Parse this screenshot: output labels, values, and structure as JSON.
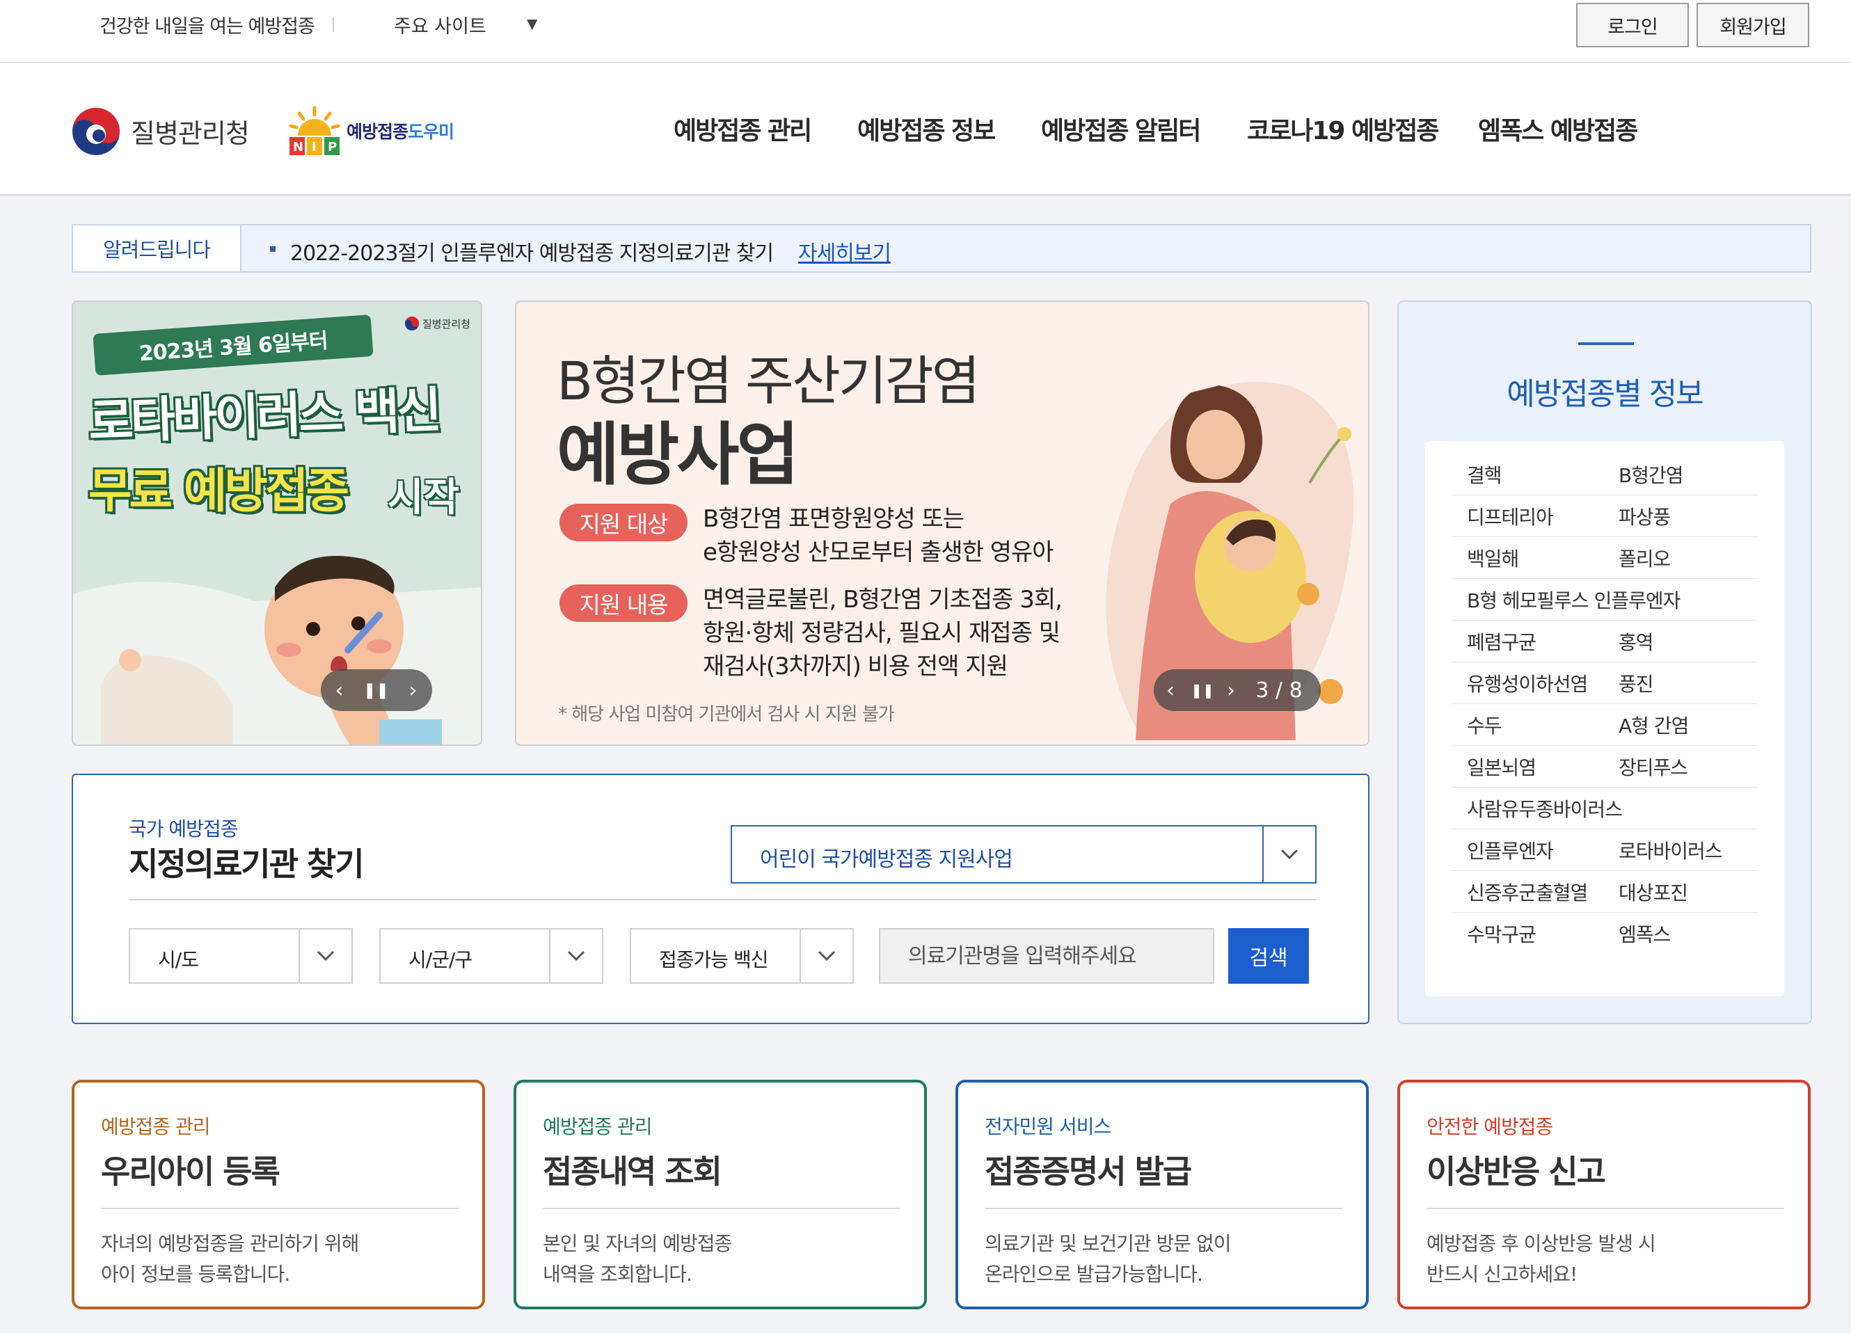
{
  "utility": {
    "slogan": "건강한 내일을 여는 예방접종",
    "sites_label": "주요 사이트",
    "login": "로그인",
    "join": "회원가입"
  },
  "header": {
    "kdca_name": "질병관리청",
    "nip_brand_a": "예방접종",
    "nip_brand_b": "도우미",
    "nav": [
      "예방접종 관리",
      "예방접종 정보",
      "예방접종 알림터",
      "코로나19 예방접종",
      "엠폭스 예방접종"
    ]
  },
  "notice": {
    "label": "알려드립니다",
    "text": "2022-2023절기 인플루엔자 예방접종 지정의료기관 찾기",
    "more": "자세히보기"
  },
  "banner1": {
    "date": "2023년 3월 6일부터",
    "line1": "로타바이러스 백신",
    "line2": "무료 예방접종",
    "line2_end": "시작",
    "kdca": "질병관리청"
  },
  "banner2": {
    "title1": "B형간염 주산기감염",
    "title2": "예방사업",
    "tag1": "지원 대상",
    "desc1_l1": "B형간염 표면항원양성 또는",
    "desc1_l2": "e항원양성 산모로부터 출생한 영유아",
    "tag2": "지원 내용",
    "desc2_l1": "면역글로불린, B형간염 기초접종 3회,",
    "desc2_l2": "항원·항체 정량검사, 필요시 재접종 및",
    "desc2_l3": "재검사(3차까지) 비용 전액 지원",
    "note": "* 해당 사업 미참여 기관에서 검사 시 지원 불가",
    "counter": "3 / 8"
  },
  "info_panel": {
    "title": "예방접종별 정보",
    "rows": [
      [
        "결핵",
        "B형간염"
      ],
      [
        "디프테리아",
        "파상풍"
      ],
      [
        "백일해",
        "폴리오"
      ],
      [
        "B형 헤모필루스 인플루엔자",
        ""
      ],
      [
        "폐렴구균",
        "홍역"
      ],
      [
        "유행성이하선염",
        "풍진"
      ],
      [
        "수두",
        "A형 간염"
      ],
      [
        "일본뇌염",
        "장티푸스"
      ],
      [
        "사람유두종바이러스",
        ""
      ],
      [
        "인플루엔자",
        "로타바이러스"
      ],
      [
        "신증후군출혈열",
        "대상포진"
      ],
      [
        "수막구균",
        "엠폭스"
      ]
    ]
  },
  "search": {
    "sub": "국가 예방접종",
    "heading": "지정의료기관 찾기",
    "program": "어린이 국가예방접종 지원사업",
    "sido": "시/도",
    "sigungu": "시/군/구",
    "vaccine": "접종가능 백신",
    "placeholder": "의료기관명을 입력해주세요",
    "button": "검색"
  },
  "cards": [
    {
      "category": "예방접종 관리",
      "title": "우리아이 등록",
      "desc": "자녀의 예방접종을 관리하기 위해\n아이 정보를 등록합니다.",
      "color": "#b5651d"
    },
    {
      "category": "예방접종 관리",
      "title": "접종내역 조회",
      "desc": "본인 및 자녀의 예방접종\n내역을 조회합니다.",
      "color": "#1f7a5e"
    },
    {
      "category": "전자민원 서비스",
      "title": "접종증명서 발급",
      "desc": "의료기관 및 보건기관 방문 없이\n온라인으로 발급가능합니다.",
      "color": "#1e5fa8"
    },
    {
      "category": "안전한 예방접종",
      "title": "이상반응 신고",
      "desc": "예방접종 후 이상반응 발생 시\n반드시 신고하세요!",
      "color": "#d0402a"
    }
  ]
}
